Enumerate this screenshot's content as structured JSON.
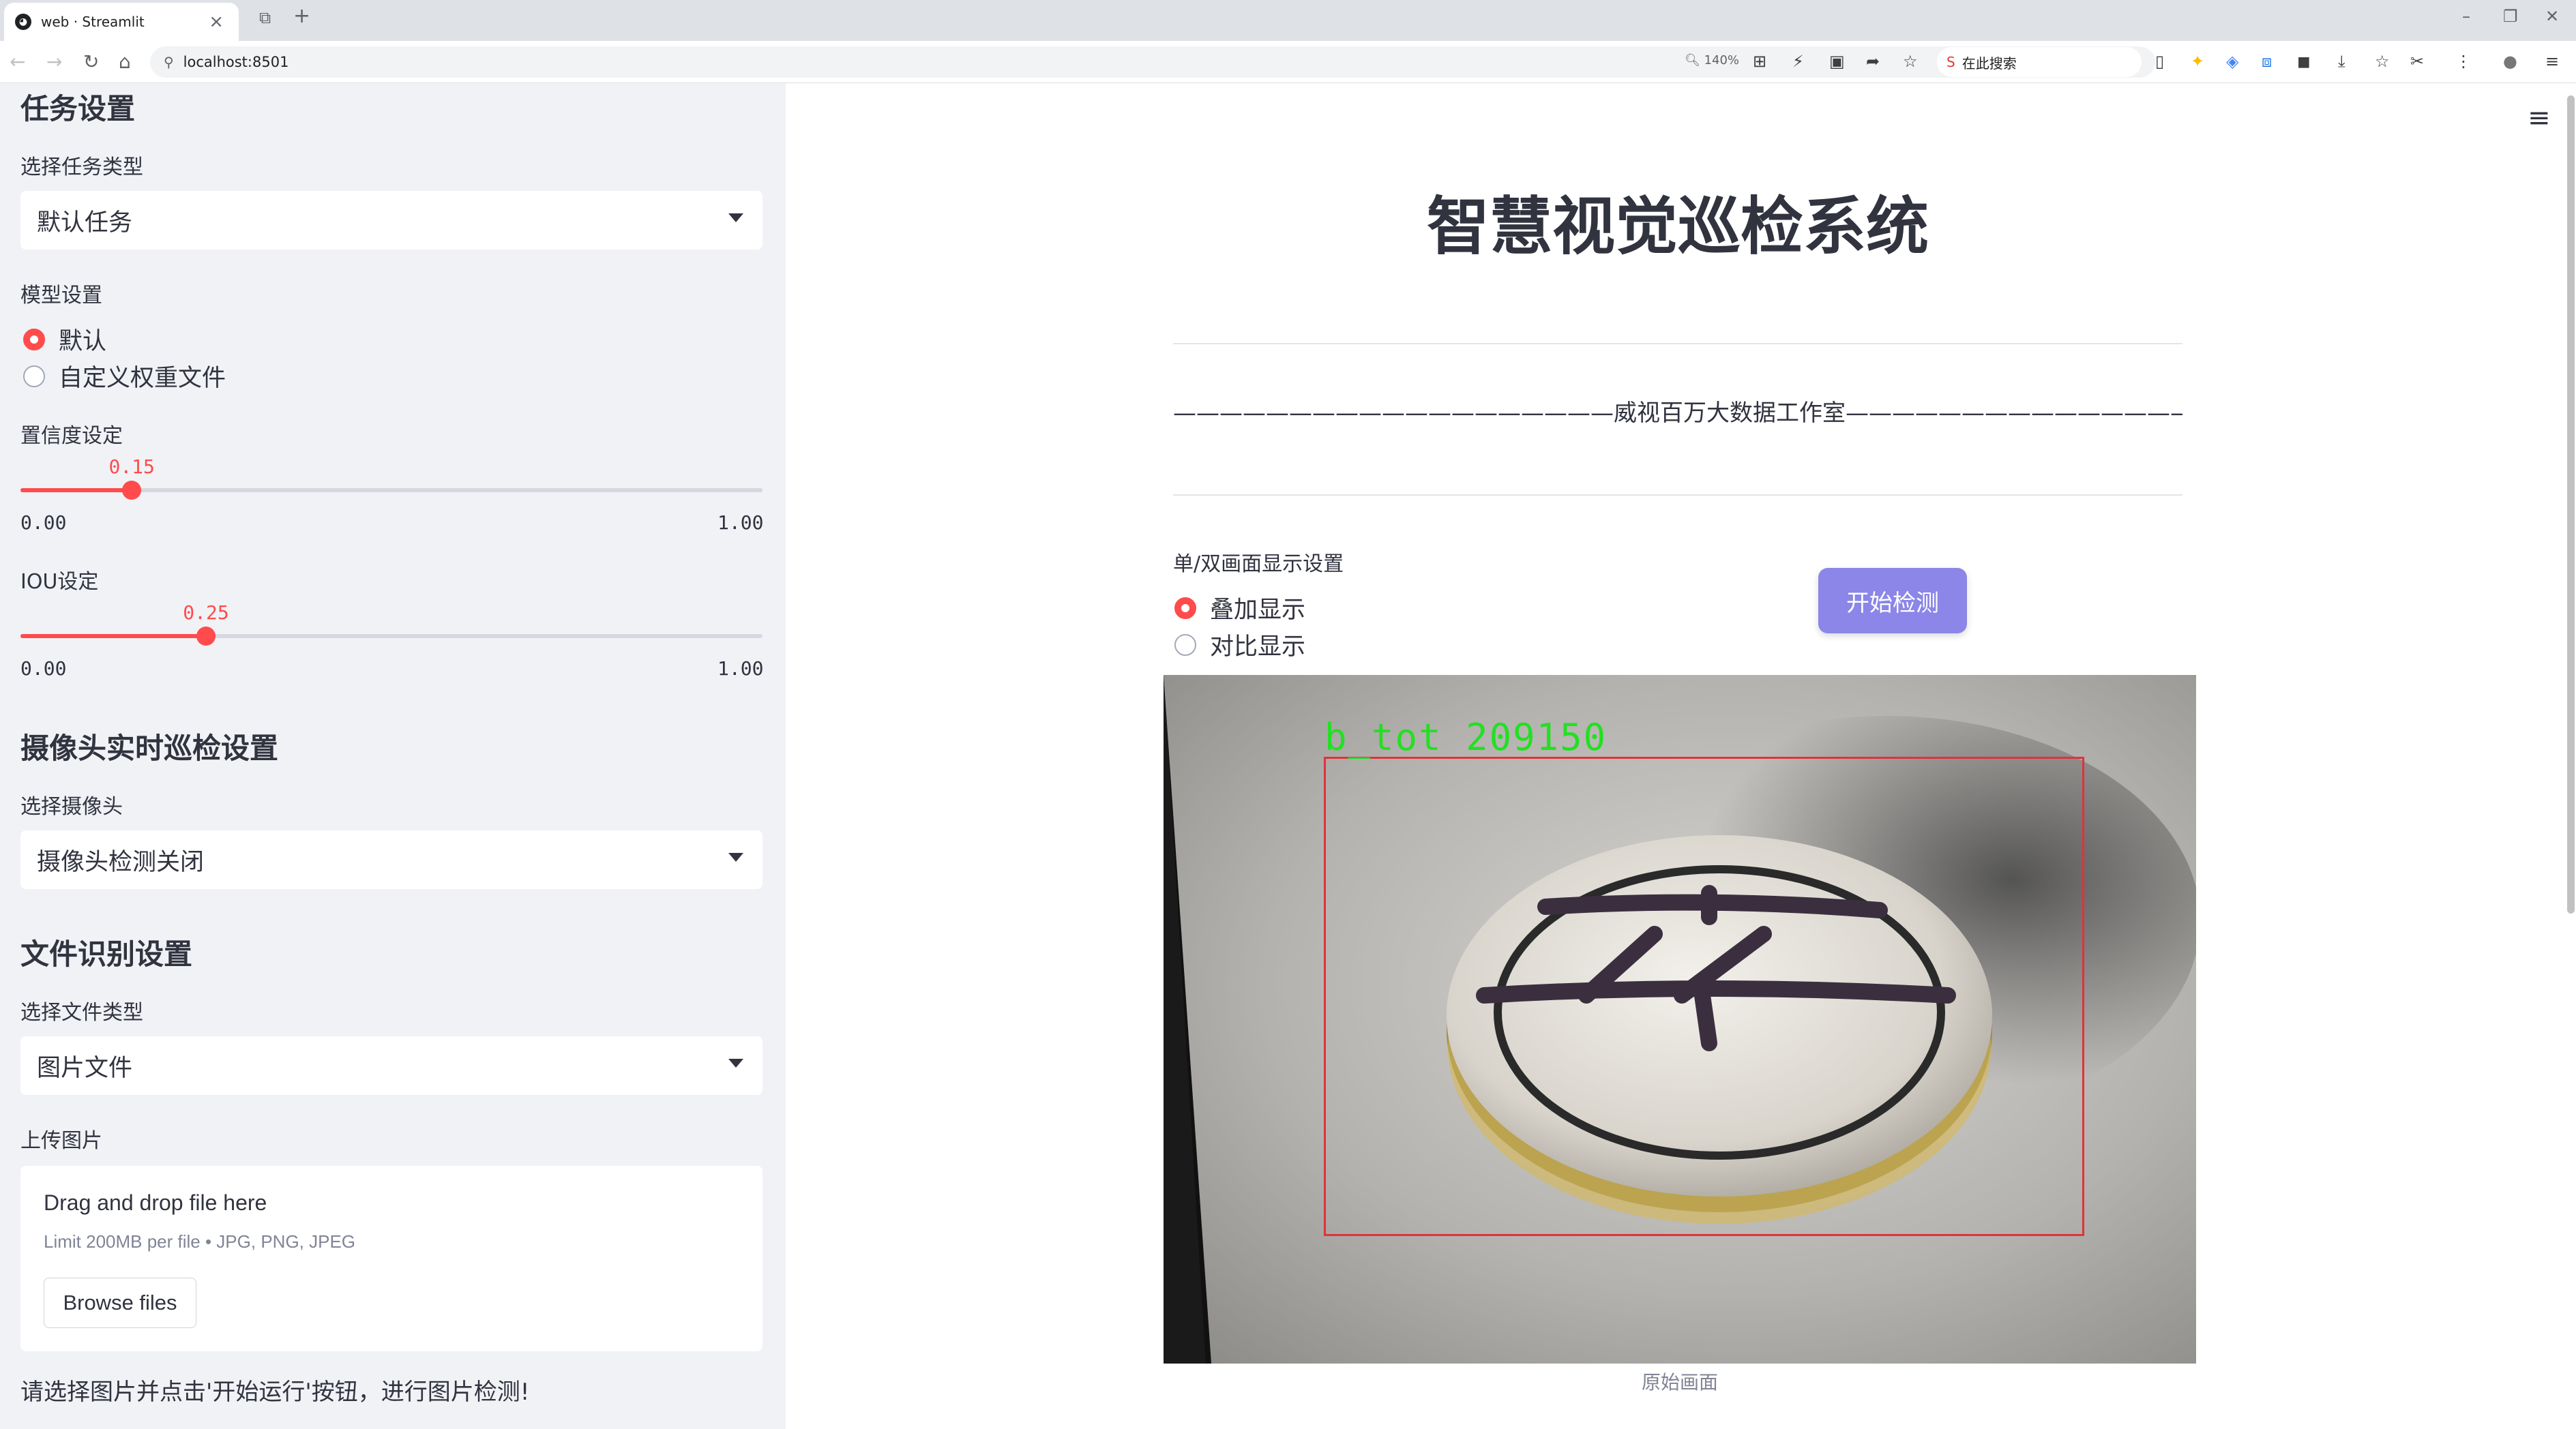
{
  "browser": {
    "tab_title": "web · Streamlit",
    "url": "localhost:8501",
    "zoom": "140%",
    "search_placeholder": "在此搜索"
  },
  "sidebar": {
    "task_section": "任务设置",
    "task_type_label": "选择任务类型",
    "task_type_value": "默认任务",
    "model_label": "模型设置",
    "model_options": [
      "默认",
      "自定义权重文件"
    ],
    "model_selected": 0,
    "conf_label": "置信度设定",
    "conf_value": "0.15",
    "conf_fraction": 0.15,
    "conf_min": "0.00",
    "conf_max": "1.00",
    "iou_label": "IOU设定",
    "iou_value": "0.25",
    "iou_fraction": 0.25,
    "iou_min": "0.00",
    "iou_max": "1.00",
    "camera_section": "摄像头实时巡检设置",
    "camera_label": "选择摄像头",
    "camera_value": "摄像头检测关闭",
    "file_section": "文件识别设置",
    "file_type_label": "选择文件类型",
    "file_type_value": "图片文件",
    "upload_label": "上传图片",
    "drop_text": "Drag and drop file here",
    "limit_text": "Limit 200MB per file • JPG, PNG, JPEG",
    "browse_label": "Browse files",
    "hint_text": "请选择图片并点击'开始运行'按钮，进行图片检测!"
  },
  "main": {
    "title": "智慧视觉巡检系统",
    "subtitle": "———————————————————威视百万大数据工作室————————————————————",
    "display_label": "单/双画面显示设置",
    "display_options": [
      "叠加显示",
      "对比显示"
    ],
    "display_selected": 0,
    "start_button": "开始检测",
    "detection_label": "b_tot 209150",
    "caption": "原始画面"
  },
  "colors": {
    "accent": "#ff4b4b",
    "primary_button": "#8b86e8",
    "detection_box": "#e0323c",
    "detection_text": "#22e022"
  }
}
